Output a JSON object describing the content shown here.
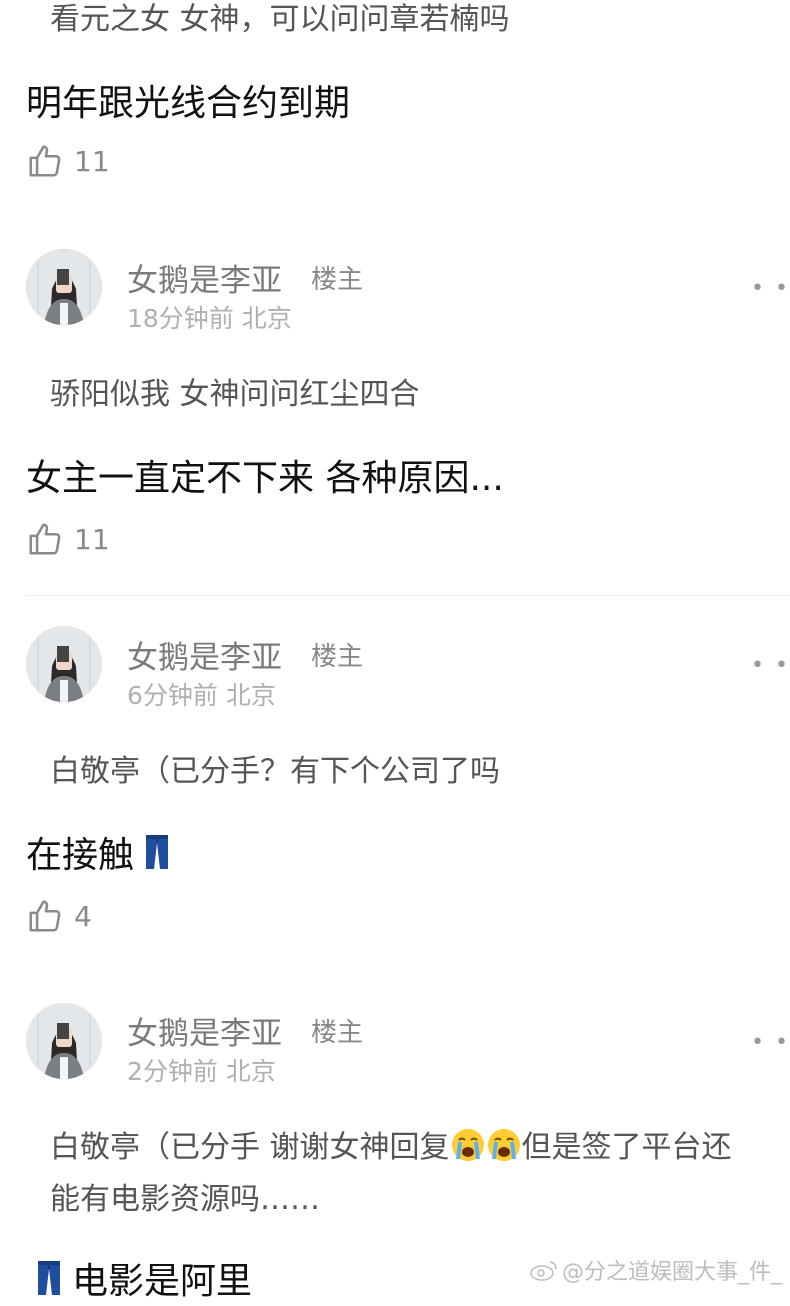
{
  "comments": [
    {
      "quote": "看元之女 女神，可以问问章若楠吗",
      "reply": "明年跟光线合约到期",
      "likes": "11"
    },
    {
      "user": "女鹅是李亚",
      "tag": "楼主",
      "time": "18分钟前",
      "location": "北京",
      "quote": "骄阳似我 女神问问红尘四合",
      "reply": "女主一直定不下来 各种原因...",
      "likes": "11"
    },
    {
      "user": "女鹅是李亚",
      "tag": "楼主",
      "time": "6分钟前",
      "location": "北京",
      "quote": "白敬亭（已分手？有下个公司了吗",
      "reply": "在接触",
      "likes": "4"
    },
    {
      "user": "女鹅是李亚",
      "tag": "楼主",
      "time": "2分钟前",
      "location": "北京",
      "quote_line1_a": "白敬亭（已分手 谢谢女神回复",
      "quote_line1_b": "但是签了平台还",
      "quote_line2": "能有电影资源吗……",
      "reply": "电影是阿里"
    }
  ],
  "icons": {
    "like": "thumbs-up-icon",
    "more": "more-dots-icon",
    "jeans": "jeans-emoji",
    "cry": "loudly-crying-face-emoji"
  },
  "watermark": "@分之道娱圈大事_件_"
}
